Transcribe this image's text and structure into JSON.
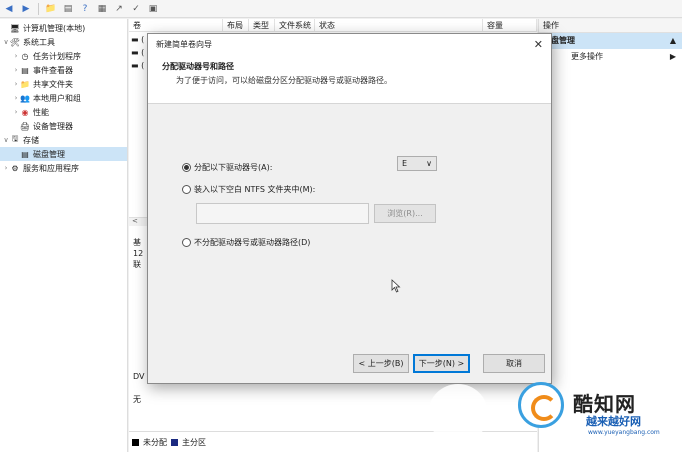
{
  "tree": {
    "root": "计算机管理(本地)",
    "system_tools": "系统工具",
    "task_scheduler": "任务计划程序",
    "event_viewer": "事件查看器",
    "shared_folders": "共享文件夹",
    "local_users": "本地用户和组",
    "performance": "性能",
    "device_manager": "设备管理器",
    "storage": "存储",
    "disk_management": "磁盘管理",
    "services_apps": "服务和应用程序"
  },
  "center": {
    "columns": [
      "卷",
      "布局",
      "类型",
      "文件系统",
      "状态",
      "容量"
    ],
    "rows": [
      "(",
      "(",
      "("
    ],
    "disk_label_1": "基",
    "disk_label_2": "12",
    "disk_label_3": "联",
    "cd_label_1": "DV",
    "cd_label_2": "无",
    "legend": [
      {
        "label": "未分配",
        "color": "#000000"
      },
      {
        "label": "主分区",
        "color": "#1b2a80"
      }
    ]
  },
  "actions": {
    "header": "操作",
    "section": "磁盘管理",
    "more": "更多操作"
  },
  "dialog": {
    "title": "新建简单卷向导",
    "heading": "分配驱动器号和路径",
    "description": "为了便于访问，可以给磁盘分区分配驱动器号或驱动器路径。",
    "option_assign": "分配以下驱动器号(A):",
    "drive_letter": "E",
    "option_mount": "装入以下空白 NTFS 文件夹中(M):",
    "browse": "浏览(R)...",
    "option_none": "不分配驱动器号或驱动器路径(D)",
    "back": "< 上一步(B)",
    "next": "下一步(N) >",
    "cancel": "取消"
  },
  "watermark": {
    "name": "酷知网",
    "sub": "越来越好网",
    "url": "www.yueyangbang.com"
  }
}
